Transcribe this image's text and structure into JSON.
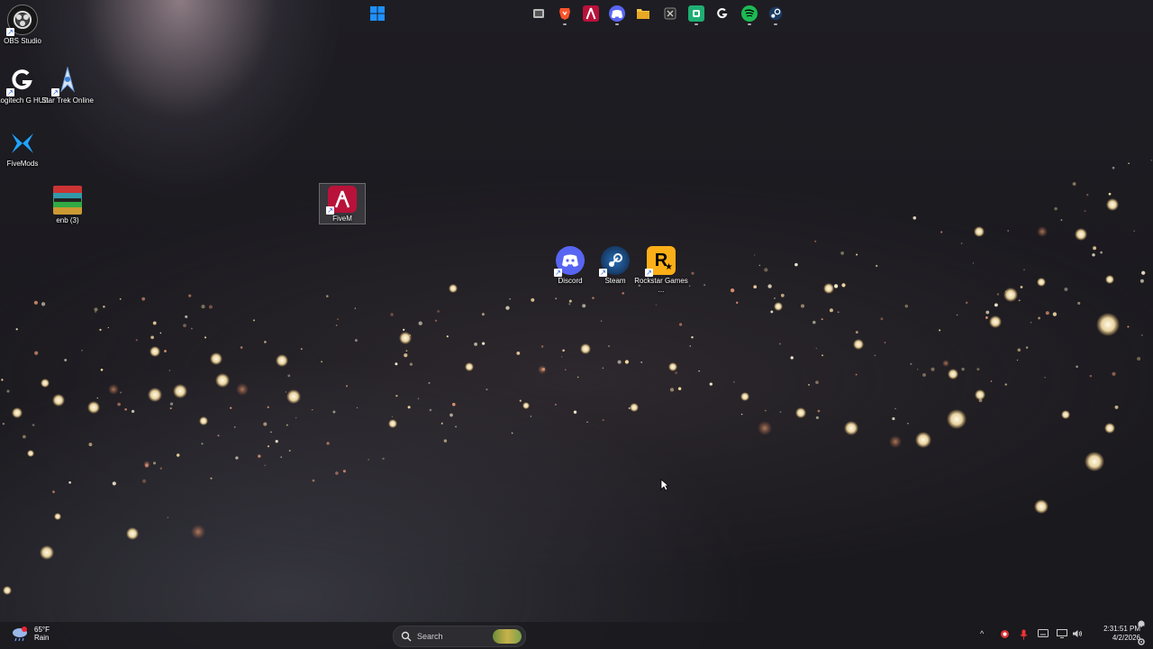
{
  "desktop": {
    "icons": [
      {
        "label": "OBS Studio"
      },
      {
        "label": "Logitech G HUB"
      },
      {
        "label": "Star Trek Online"
      },
      {
        "label": "FiveMods"
      },
      {
        "label": "enb (3)"
      },
      {
        "label": "FiveM"
      },
      {
        "label": "Discord"
      },
      {
        "label": "Steam"
      },
      {
        "label": "Rockstar Games ..."
      }
    ]
  },
  "taskbar": {
    "weather": {
      "temp": "65°F",
      "condition": "Rain",
      "icon": "rain-cloud-icon"
    },
    "search_placeholder": "Search",
    "pinned_apps": [
      {
        "name": "start-icon"
      },
      {
        "name": "task-view-icon"
      },
      {
        "name": "brave-browser-icon"
      },
      {
        "name": "fivem-icon"
      },
      {
        "name": "discord-icon"
      },
      {
        "name": "file-explorer-icon"
      },
      {
        "name": "capcut-icon"
      },
      {
        "name": "app-green-icon"
      },
      {
        "name": "logitech-ghub-icon"
      },
      {
        "name": "spotify-icon"
      },
      {
        "name": "steam-icon"
      }
    ],
    "clock": {
      "time": "2:31:51 PM",
      "date": "4/2/2026"
    }
  },
  "colors": {
    "taskbar_bg": "#1a1a1e",
    "discord": "#5865f2",
    "fivem": "#c8143c",
    "rockstar": "#fcaf17",
    "spotify": "#1db954",
    "windows_blue": "#1e90ff"
  }
}
